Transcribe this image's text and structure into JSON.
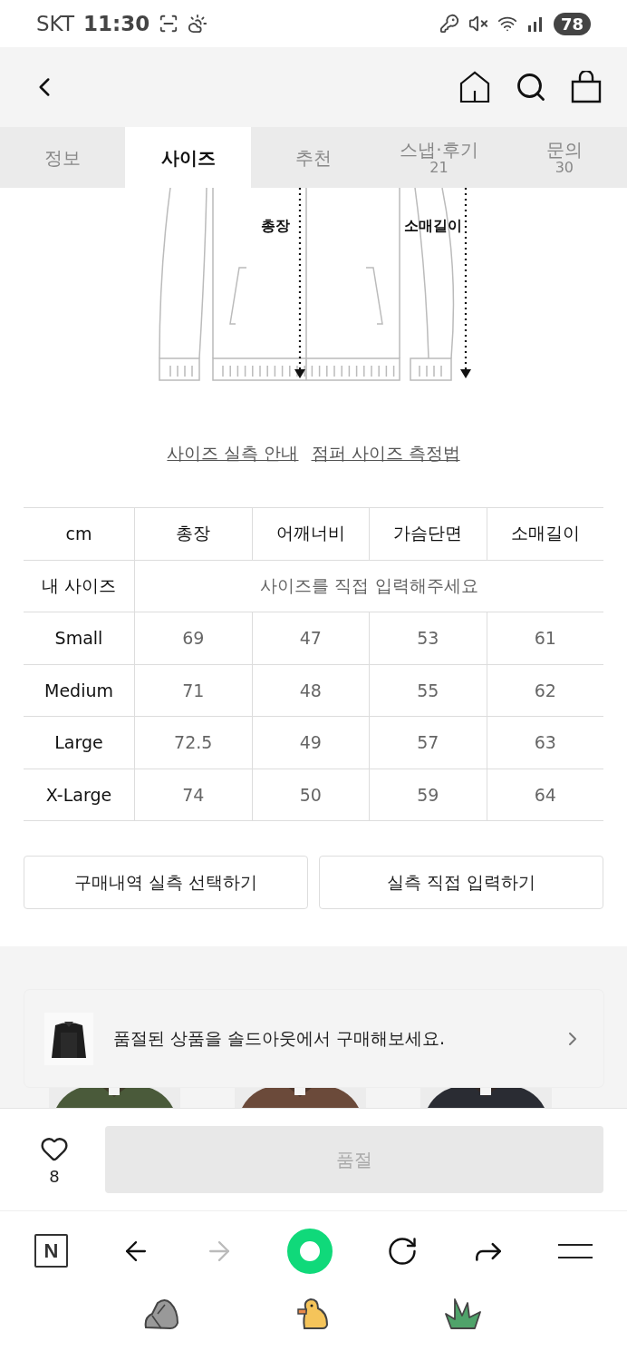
{
  "status_bar": {
    "carrier": "SKT",
    "time": "11:30",
    "battery": "78"
  },
  "tabs": [
    {
      "label": "정보",
      "selected": false
    },
    {
      "label": "사이즈",
      "selected": true
    },
    {
      "label": "추천",
      "selected": false
    },
    {
      "label": "스냅·후기",
      "count": "21",
      "selected": false
    },
    {
      "label": "문의",
      "count": "30",
      "selected": false
    }
  ],
  "diagram": {
    "labels": [
      "총장",
      "소매길이"
    ]
  },
  "guide_links": [
    "사이즈 실측 안내",
    "점퍼 사이즈 측정법"
  ],
  "size_table": {
    "columns": [
      "cm",
      "총장",
      "어깨너비",
      "가슴단면",
      "소매길이"
    ],
    "my_size": {
      "label": "내 사이즈",
      "placeholder": "사이즈를 직접 입력해주세요"
    },
    "rows": [
      {
        "size": "Small",
        "values": [
          "69",
          "47",
          "53",
          "61"
        ]
      },
      {
        "size": "Medium",
        "values": [
          "71",
          "48",
          "55",
          "62"
        ]
      },
      {
        "size": "Large",
        "values": [
          "72.5",
          "49",
          "57",
          "63"
        ]
      },
      {
        "size": "X-Large",
        "values": [
          "74",
          "50",
          "59",
          "64"
        ]
      }
    ]
  },
  "actions": [
    "구매내역 실측 선택하기",
    "실측 직접 입력하기"
  ],
  "recommended_items": [
    {
      "kind": "picture"
    },
    {
      "kind": "picture"
    },
    {
      "kind": "picture"
    }
  ],
  "toast": {
    "text": "품절된 상품을 솔드아웃에서 구매해보세요."
  },
  "purchase_bar": {
    "like_count": "8",
    "button": "품절",
    "disabled": true
  },
  "browser_bar": {
    "logo": "N",
    "forward_disabled": true
  }
}
